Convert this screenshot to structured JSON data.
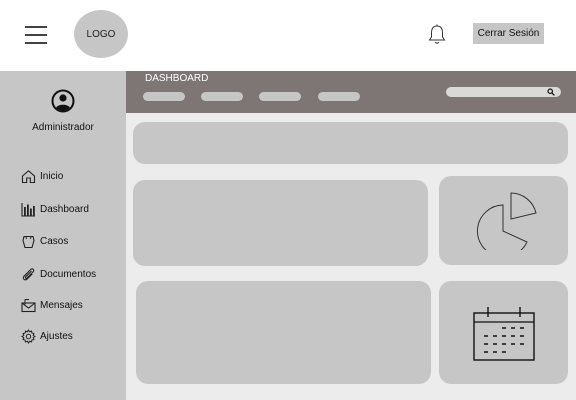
{
  "header": {
    "logo_text": "LOGO",
    "logout_label": "Cerrar Sesión",
    "menu_icon": "hamburger-menu-icon",
    "notification_icon": "bell-icon"
  },
  "sidebar": {
    "user_icon": "user-circle-icon",
    "user_label": "Administrador",
    "items": [
      {
        "label": "Inicio",
        "icon": "home-icon"
      },
      {
        "label": "Dashboard",
        "icon": "bar-chart-icon"
      },
      {
        "label": "Casos",
        "icon": "briefcase-icon"
      },
      {
        "label": "Documentos",
        "icon": "paperclip-icon"
      },
      {
        "label": "Mensajes",
        "icon": "envelope-icon"
      },
      {
        "label": "Ajustes",
        "icon": "gear-icon"
      }
    ]
  },
  "main": {
    "section_title": "DASHBOARD",
    "search_icon": "search-icon",
    "widgets": [
      {
        "icon": "pie-chart-icon"
      },
      {
        "icon": "calendar-icon"
      }
    ]
  },
  "colors": {
    "header_bar": "#7e7575",
    "sidebar_bg": "#c6c6c6",
    "main_bg": "#ececec",
    "placeholder": "#c6c6c6"
  }
}
